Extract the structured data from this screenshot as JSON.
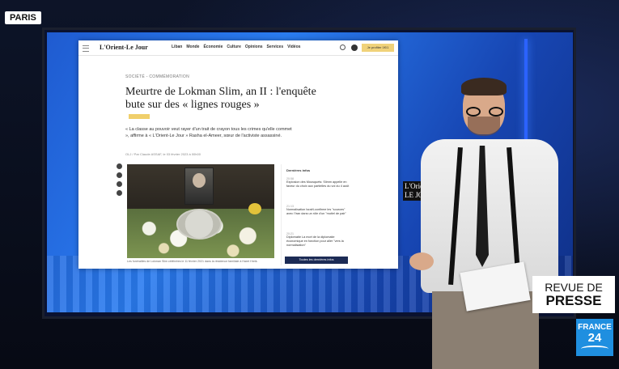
{
  "location": "PARIS",
  "site": {
    "logo": "L'Orient-Le Jour",
    "nav": [
      "Liban",
      "Monde",
      "Économie",
      "Culture",
      "Opinions",
      "Services",
      "Vidéos"
    ],
    "subscribe_label": "Je profiter 1€/1"
  },
  "article": {
    "category": "SOCIÉTÉ - COMMÉMORATION",
    "headline": "Meurtre de Lokman Slim, an II : l'enquête bute sur des « lignes rouges »",
    "lead": "« La classe au pouvoir veut rayer d'un trait de crayon tous les crimes qu'elle commet », affirme à « L'Orient-Le Jour » Rasha el-Ameer, sœur de l'activiste assassiné.",
    "byline": "OLJ / Par Claude ASSAF, le 03 février 2023 à 00h00",
    "caption": "Les funérailles de Lokman Slim célébrées le 11 février 2021 dans la résidence familiale à Haret Hreik."
  },
  "sidebar": {
    "title": "Dernières infos",
    "items": [
      {
        "time": "20:58",
        "text": "Explosion des Mousquets: Slimm appelle en faveur du choix aux partielles du vol du 4 août"
      },
      {
        "time": "21:13",
        "text": "Normalisation Israël-confirme les \"sources\" avec l'Iran dans un rôle d'un \"mutiel de pair\""
      },
      {
        "time": "20:21",
        "text": "Diplomatie La mort de la diplomatie économique en fonction pour aller \"vers la normalisation\""
      }
    ],
    "button": "Toutes les dernières infos"
  },
  "background_logo": "L'Orient LE JO",
  "program_badge": {
    "line1": "REVUE DE",
    "line2": "PRESSE"
  },
  "channel": {
    "line1": "FRANCE",
    "line2": "24"
  }
}
